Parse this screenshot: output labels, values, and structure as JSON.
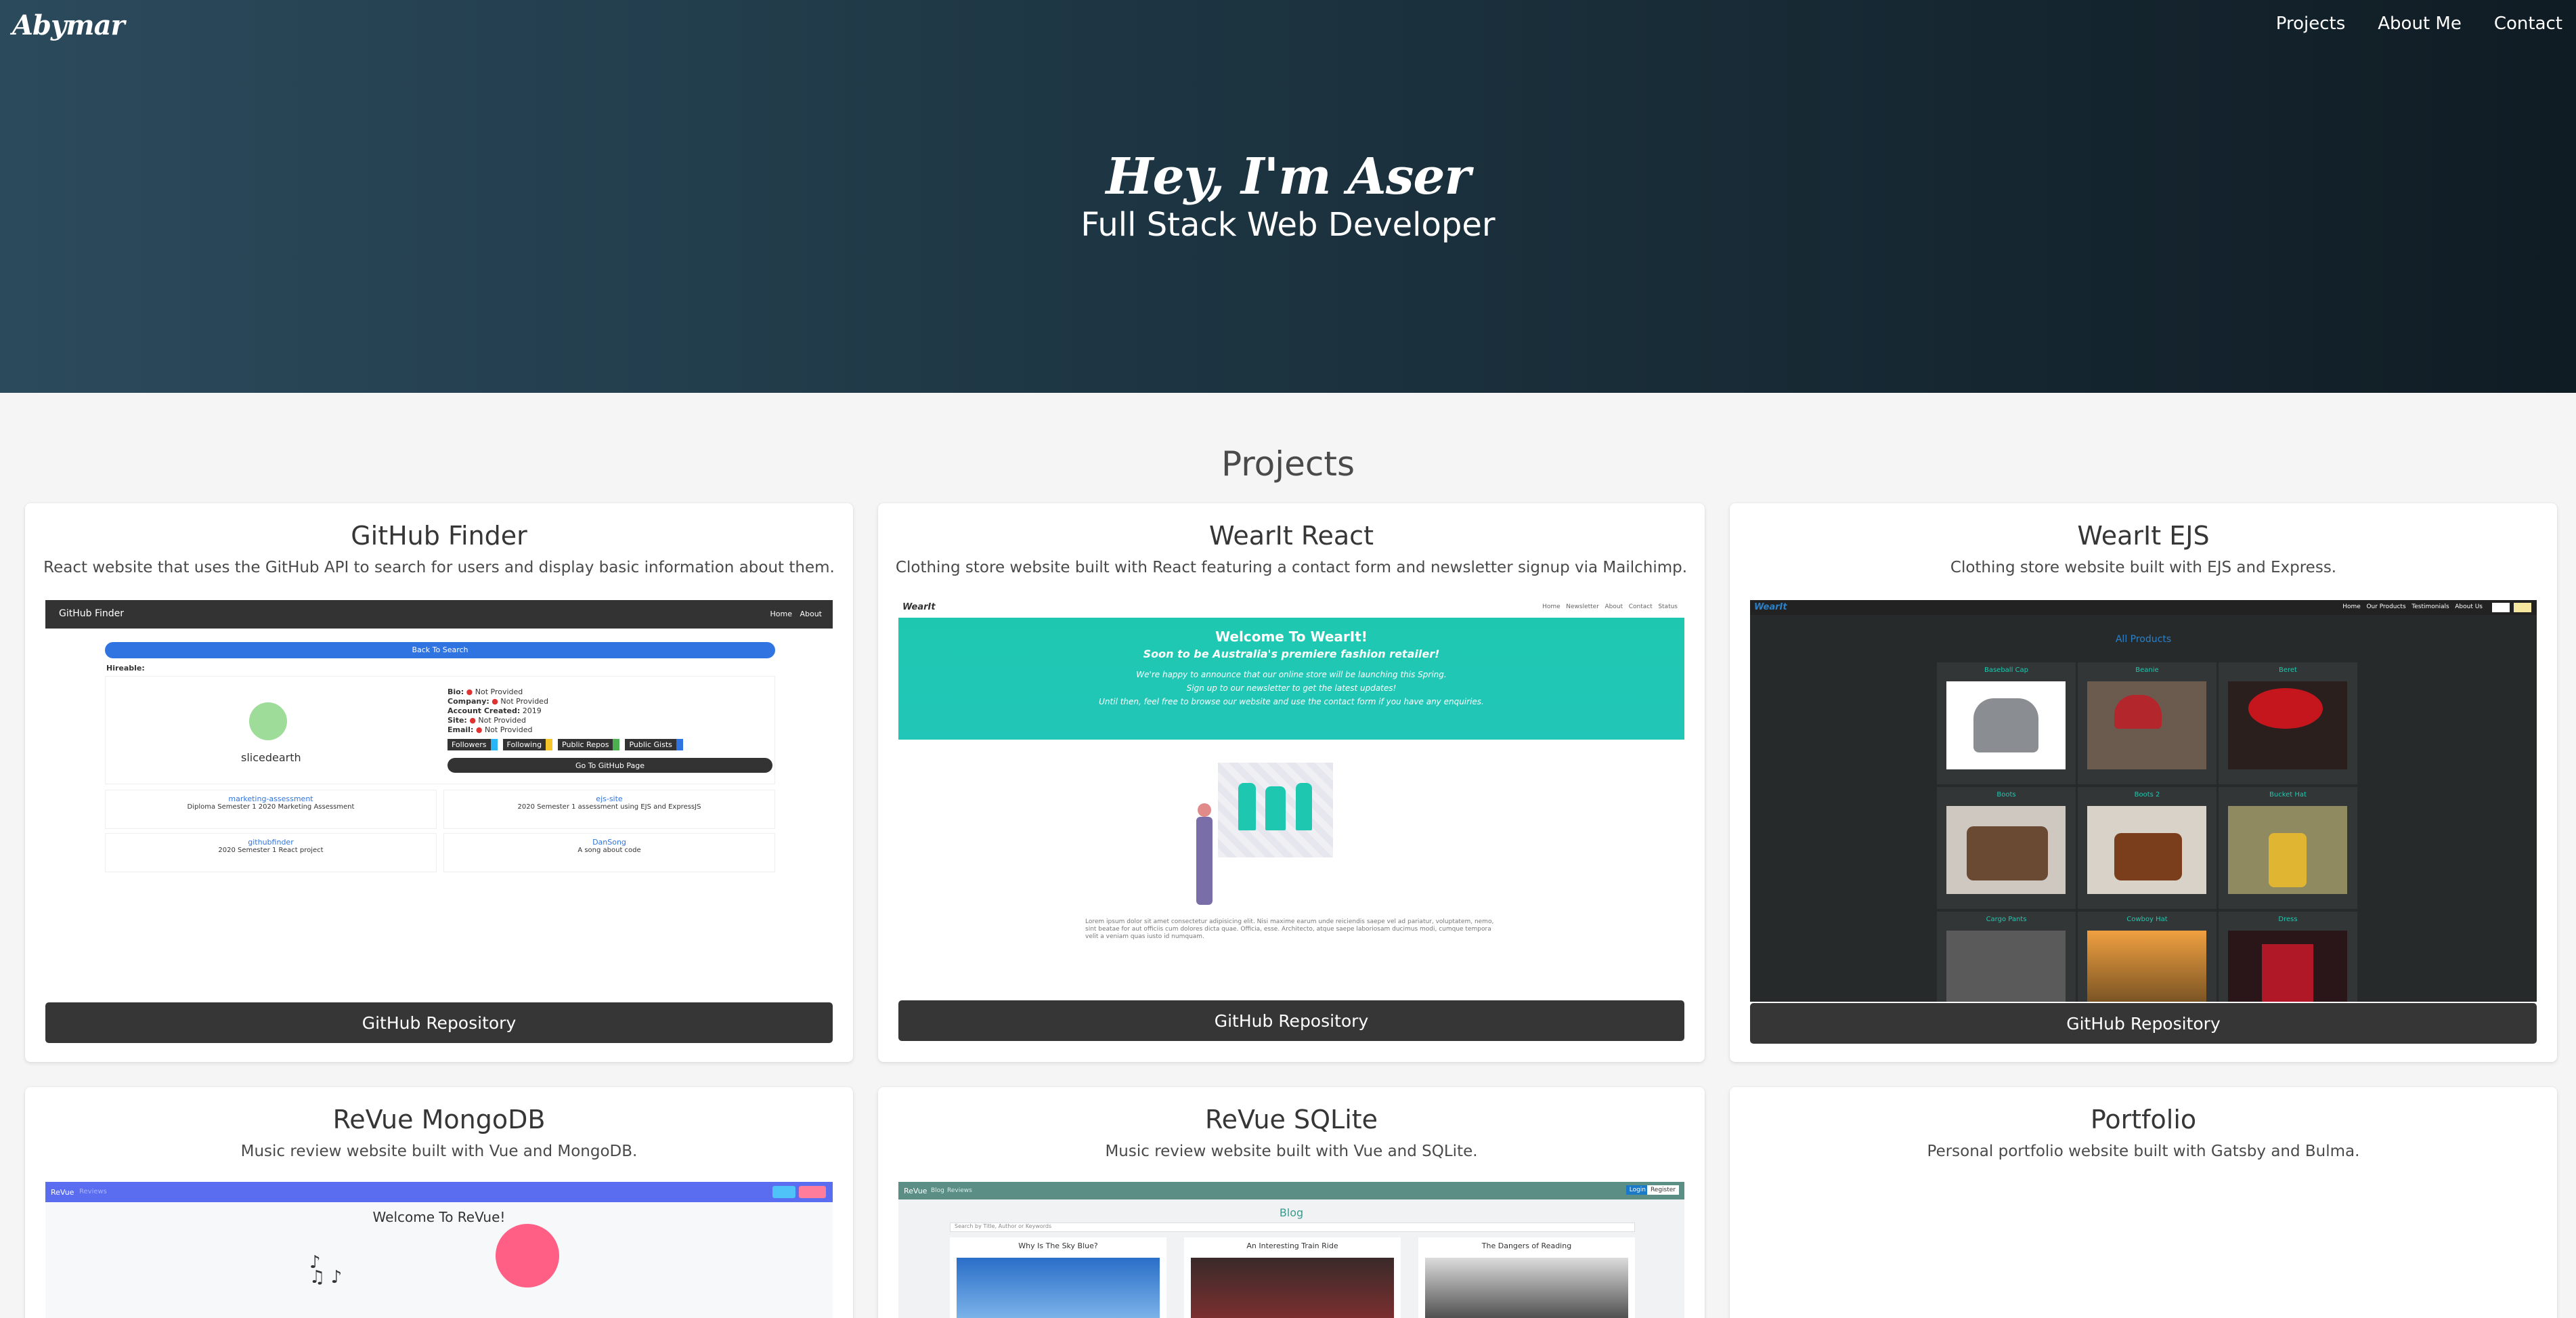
{
  "nav": {
    "brand": "Abymar",
    "links": [
      "Projects",
      "About Me",
      "Contact"
    ]
  },
  "hero": {
    "title": "Hey, I'm Aser",
    "subtitle": "Full Stack Web Developer"
  },
  "projects_title": "Projects",
  "repo_label": "GitHub Repository",
  "projects": [
    {
      "title": "GitHub Finder",
      "desc": "React website that uses the GitHub API to search for users and display basic information about them."
    },
    {
      "title": "WearIt React",
      "desc": "Clothing store website built with React featuring a contact form and newsletter signup via Mailchimp."
    },
    {
      "title": "WearIt EJS",
      "desc": "Clothing store website built with EJS and Express."
    },
    {
      "title": "ReVue MongoDB",
      "desc": "Music review website built with Vue and MongoDB."
    },
    {
      "title": "ReVue SQLite",
      "desc": "Music review website built with Vue and SQLite."
    },
    {
      "title": "Portfolio",
      "desc": "Personal portfolio website built with Gatsby and Bulma."
    }
  ],
  "shots": {
    "ghf": {
      "brand": "GitHub Finder",
      "nav": [
        "Home",
        "About"
      ],
      "back": "Back To Search",
      "hireable": "Hireable:",
      "username": "slicedearth",
      "fields": [
        "Bio:",
        "Company:",
        "Account Created:",
        "Site:",
        "Email:"
      ],
      "values": [
        "Not Provided",
        "Not Provided",
        "2019",
        "Not Provided",
        "Not Provided"
      ],
      "badges": [
        "Followers",
        "Following",
        "Public Repos",
        "Public Gists"
      ],
      "goto": "Go To GitHub Page",
      "repos": [
        {
          "name": "marketing-assessment",
          "desc": "Diploma Semester 1 2020 Marketing Assessment"
        },
        {
          "name": "ejs-site",
          "desc": "2020 Semester 1 assessment using EJS and ExpressJS"
        },
        {
          "name": "githubfinder",
          "desc": "2020 Semester 1 React project"
        },
        {
          "name": "DanSong",
          "desc": "A song about code"
        }
      ]
    },
    "wir": {
      "brand": "WearIt",
      "nav": [
        "Home",
        "Newsletter",
        "About",
        "Contact",
        "Status"
      ],
      "banner_title": "Welcome To WearIt!",
      "banner_sub": "Soon to be Australia's premiere fashion retailer!",
      "banner_lines": [
        "We're happy to announce that our online store will be launching this Spring.",
        "Sign up to our newsletter to get the latest updates!",
        "Until then, feel free to browse our website and use the contact form if you have any enquiries."
      ],
      "lorem": "Lorem ipsum dolor sit amet consectetur adipisicing elit. Nisi maxime earum unde reiciendis saepe vel ad pariatur, voluptatem, nemo, sint beatae for aut officiis cum dolores dicta quae. Officia, esse. Architecto, atque saepe laboriosam ducimus modi, cumque tempora velit a veniam quas iusto id numquam."
    },
    "wie": {
      "brand": "WearIt",
      "nav": [
        "Home",
        "Our Products",
        "Testimonials",
        "About Us"
      ],
      "heading": "All Products",
      "items": [
        "Baseball Cap",
        "Beanie",
        "Beret",
        "Boots",
        "Boots 2",
        "Bucket Hat",
        "Cargo Pants",
        "Cowboy Hat",
        "Dress"
      ]
    },
    "rvm": {
      "brand": "ReVue",
      "nav": [
        "Reviews"
      ],
      "welcome": "Welcome To ReVue!"
    },
    "rvs": {
      "brand": "ReVue",
      "nav": [
        "Blog",
        "Reviews"
      ],
      "buttons": [
        "Login",
        "Register"
      ],
      "heading": "Blog",
      "search": "Search by Title, Author or Keywords",
      "posts": [
        "Why Is The Sky Blue?",
        "An Interesting Train Ride",
        "The Dangers of Reading"
      ]
    }
  },
  "colors": {
    "hero_left": "#2b4a5c",
    "hero_right": "#101c24",
    "dark_button": "#363636",
    "teal": "#1ec8b0"
  }
}
